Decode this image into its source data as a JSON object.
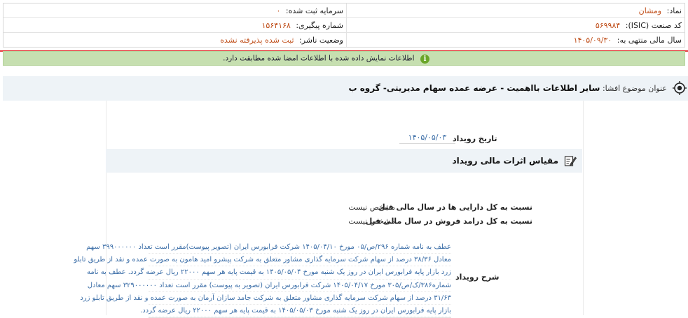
{
  "info": {
    "symbol_label": "نماد:",
    "symbol_value": "ومشان",
    "capital_label": "سرمایه ثبت شده:",
    "capital_value": "۰",
    "isic_label": "کد صنعت (ISIC):",
    "isic_value": "۵۶۹۹۸۴",
    "tracking_label": "شماره پیگیری:",
    "tracking_value": "۱۵۶۴۱۶۸",
    "fiscal_label": "سال مالی منتهی به:",
    "fiscal_value": "۱۴۰۵/۰۹/۳۰",
    "status_label": "وضعیت ناشر:",
    "status_value": "ثبت شده پذیرفته نشده"
  },
  "notice": {
    "icon": "info-icon",
    "text": "اطلاعات نمایش داده شده با اطلاعات امضا شده مطابقت دارد."
  },
  "subject": {
    "icon": "target-icon",
    "label": "عنوان موضوع افشا:",
    "value": "سایر اطلاعات بااهمیت - عرضه عمده سهام مدیریتی- گروه ب"
  },
  "event": {
    "date_label": "تاریخ رویداد",
    "date_value": "۱۴۰۵/۰۵/۰۳"
  },
  "financial": {
    "title": "مقیاس اثرات مالی رویداد",
    "icon": "edit-icon",
    "assets_label": "نسبت به کل دارایی ها در سال مالی قبل",
    "assets_value": "مشخص نیست",
    "revenue_label": "نسبت به کل درامد فروش در سال مالی قبل",
    "revenue_value": "مشخص نیست"
  },
  "description": {
    "label": "شرح رویداد",
    "lines": [
      "عطف به نامه شماره ۲۹۶/ص/۰۵ مورخ ۱۴۰۵/۰۴/۱۰ شرکت فرابورس ایران (تصویر پیوست)مقرر است تعداد ۳۹۹۰۰۰۰۰۰ سهم",
      "معادل ۳۸/۳۶ درصد از سهام شرکت سرمایه گذاری مشاور متعلق به شرکت پیشرو امید هامون به صورت عمده و نقد از طریق تابلو",
      "زرد بازار پایه فرابورس ایران در روز یک شنبه مورخ ۱۴۰۵/۰۵/۰۴ به قیمت پایه هر سهم ۲۲۰۰۰ ریال عرضه گردد. عطف به نامه",
      "شماره۳۸۶/ک/ص/۳۰۵ مورخ ۱۴۰۵/۰۴/۱۷ شرکت فرابورس ایران (تصویر به پیوست) مقرر است تعداد ۳۲۹۰۰۰۰۰۰ سهم معادل",
      "۳۱/۶۳ درصد از سهام شرکت سرمایه گذاری مشاور متعلق به شرکت جامد سازان آرمان به صورت عمده و نقد از طریق تابلو زرد",
      "بازار پایه فرابورس ایران در روز یک شنبه مورخ ۱۴۰۵/۰۵/۰۳ به قیمت پایه هر سهم ۲۲۰۰۰ ریال عرضه گردد."
    ]
  },
  "colors": {
    "accent_value": "#c0501c",
    "link_blue": "#3d6fa8",
    "notice_bg": "#c6dfb0",
    "danger_line": "#e33a3a"
  }
}
